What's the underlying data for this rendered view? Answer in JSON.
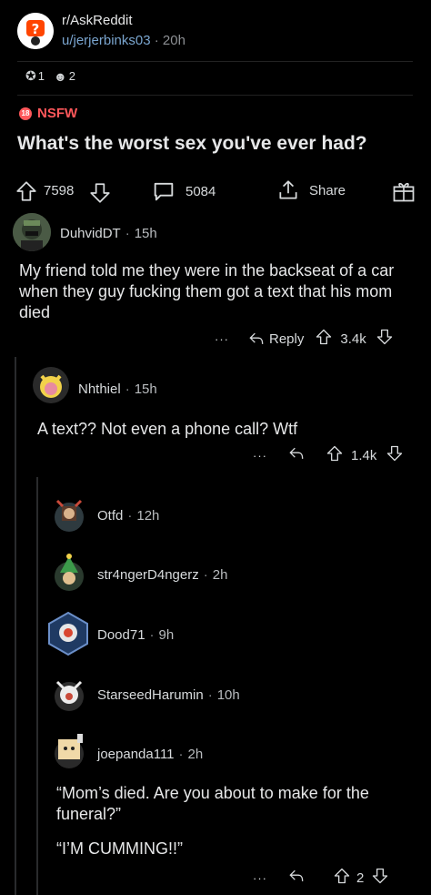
{
  "post": {
    "subreddit": "r/AskReddit",
    "author": "u/jerjerbinks03",
    "age": "20h",
    "awards_count_1": "1",
    "awards_count_2": "2",
    "nsfw_label": "NSFW",
    "title": "What's the worst sex you've ever had?",
    "upvotes": "7598",
    "comments": "5084",
    "share_label": "Share"
  },
  "comments": [
    {
      "author": "DuhvidDT",
      "age": "15h",
      "body": "My friend told me they were in the backseat of a car when they guy fucking them got a text that his mom died",
      "reply_label": "Reply",
      "score": "3.4k",
      "more": "···"
    },
    {
      "author": "Nhthiel",
      "age": "15h",
      "body": "A text?? Not even a phone call? Wtf",
      "score": "1.4k",
      "more": "···"
    },
    {
      "author": "Otfd",
      "age": "12h"
    },
    {
      "author": "str4ngerD4ngerz",
      "age": "2h"
    },
    {
      "author": "Dood71",
      "age": "9h"
    },
    {
      "author": "StarseedHarumin",
      "age": "10h"
    },
    {
      "author": "joepanda111",
      "age": "2h",
      "body_line1": "“Mom’s died. Are you about to make for the funeral?”",
      "body_line2": "“I’M CUMMING!!”",
      "score": "2",
      "more": "···"
    }
  ],
  "colors": {
    "background": "#000000",
    "nsfw": "#ff585b",
    "text": "#d7dadc",
    "muted": "#8c8f93"
  }
}
